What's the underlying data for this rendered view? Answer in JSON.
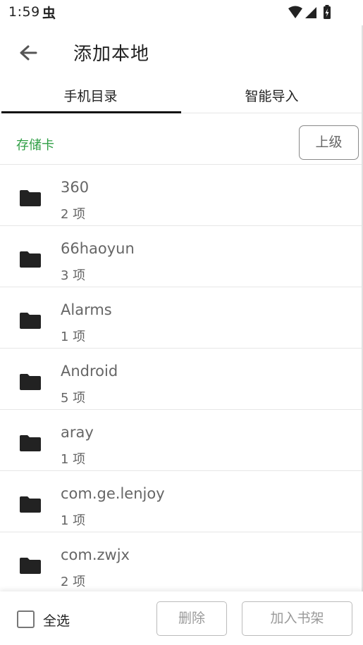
{
  "status_bar": {
    "time": "1:59",
    "notification_icon": "bug-notification-icon",
    "icons": [
      "wifi-icon",
      "signal-icon",
      "battery-charging-icon"
    ]
  },
  "app_bar": {
    "back_icon": "arrow-back-icon",
    "title": "添加本地"
  },
  "tabs": [
    {
      "label": "手机目录",
      "active": true
    },
    {
      "label": "智能导入",
      "active": false
    }
  ],
  "path": {
    "current": "存储卡",
    "up_button": "上级"
  },
  "folders": [
    {
      "name": "360",
      "count": "2 项"
    },
    {
      "name": "66haoyun",
      "count": "3 项"
    },
    {
      "name": "Alarms",
      "count": "1 项"
    },
    {
      "name": "Android",
      "count": "5 项"
    },
    {
      "name": "aray",
      "count": "1 项"
    },
    {
      "name": "com.ge.lenjoy",
      "count": "1 项"
    },
    {
      "name": "com.zwjx",
      "count": "2 项"
    }
  ],
  "bottom_bar": {
    "select_all_label": "全选",
    "select_all_checked": false,
    "delete_button": "删除",
    "add_button": "加入书架"
  },
  "colors": {
    "accent_green": "#2e9e44",
    "tab_indicator": "#111111",
    "divider": "#e6e6e6"
  }
}
